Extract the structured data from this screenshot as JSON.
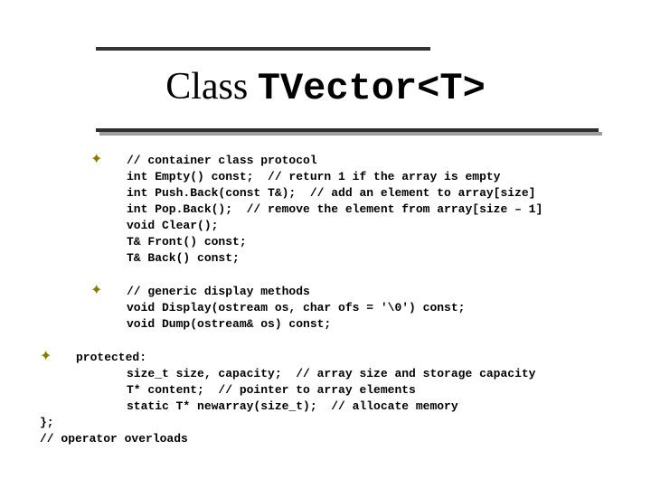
{
  "title": {
    "prefix": "Class ",
    "code": "TVector<T>"
  },
  "blocks": {
    "container": {
      "lines": [
        "// container class protocol",
        "int Empty() const;  // return 1 if the array is empty",
        "int Push.Back(const T&);  // add an element to array[size]",
        "int Pop.Back();  // remove the element from array[size – 1]",
        "void Clear();",
        "T& Front() const;",
        "T& Back() const;"
      ]
    },
    "display": {
      "lines": [
        "// generic display methods",
        "void Display(ostream os, char ofs = '\\0') const;",
        "void Dump(ostream& os) const;"
      ]
    },
    "protected": {
      "header": "protected:",
      "lines": [
        "size_t size, capacity;  // array size and storage capacity",
        "T* content;  // pointer to array elements",
        "static T* newarray(size_t);  // allocate memory"
      ],
      "tail1": "};",
      "tail2": "// operator overloads"
    }
  }
}
